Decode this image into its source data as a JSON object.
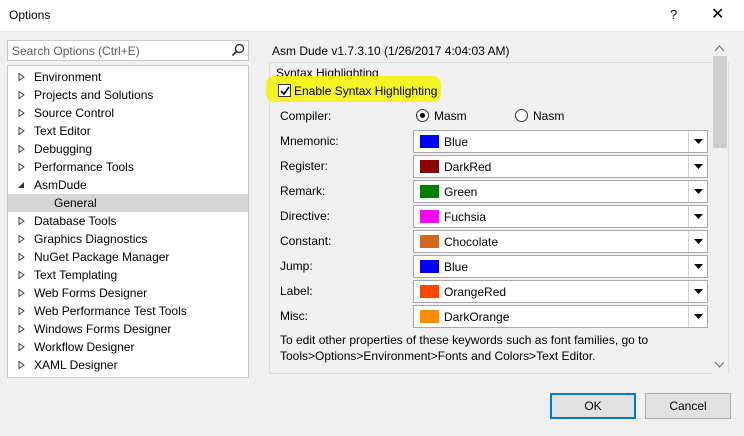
{
  "window": {
    "title": "Options",
    "help_label": "?",
    "close_label": "✕"
  },
  "search": {
    "placeholder": "Search Options (Ctrl+E)"
  },
  "tree": {
    "items": [
      {
        "label": "Environment",
        "expanded": false
      },
      {
        "label": "Projects and Solutions",
        "expanded": false
      },
      {
        "label": "Source Control",
        "expanded": false
      },
      {
        "label": "Text Editor",
        "expanded": false
      },
      {
        "label": "Debugging",
        "expanded": false
      },
      {
        "label": "Performance Tools",
        "expanded": false
      },
      {
        "label": "AsmDude",
        "expanded": true
      },
      {
        "label": "General",
        "child": true,
        "selected": true
      },
      {
        "label": "Database Tools",
        "expanded": false
      },
      {
        "label": "Graphics Diagnostics",
        "expanded": false
      },
      {
        "label": "NuGet Package Manager",
        "expanded": false
      },
      {
        "label": "Text Templating",
        "expanded": false
      },
      {
        "label": "Web Forms Designer",
        "expanded": false
      },
      {
        "label": "Web Performance Test Tools",
        "expanded": false
      },
      {
        "label": "Windows Forms Designer",
        "expanded": false
      },
      {
        "label": "Workflow Designer",
        "expanded": false
      },
      {
        "label": "XAML Designer",
        "expanded": false
      }
    ]
  },
  "panel": {
    "header": "Asm Dude v1.7.3.10 (1/26/2017 4:04:03 AM)",
    "group_label": "Syntax Highlighting",
    "enable_label": "Enable Syntax Highlighting",
    "enable_checked": true,
    "compiler": {
      "label": "Compiler:",
      "options": [
        "Masm",
        "Nasm"
      ],
      "selected": "Masm"
    },
    "colors": [
      {
        "label": "Mnemonic:",
        "value": "Blue",
        "hex": "#0000ff"
      },
      {
        "label": "Register:",
        "value": "DarkRed",
        "hex": "#8b0000"
      },
      {
        "label": "Remark:",
        "value": "Green",
        "hex": "#008000"
      },
      {
        "label": "Directive:",
        "value": "Fuchsia",
        "hex": "#ff00ff"
      },
      {
        "label": "Constant:",
        "value": "Chocolate",
        "hex": "#d2691e"
      },
      {
        "label": "Jump:",
        "value": "Blue",
        "hex": "#0000ff"
      },
      {
        "label": "Label:",
        "value": "OrangeRed",
        "hex": "#ff4500"
      },
      {
        "label": "Misc:",
        "value": "DarkOrange",
        "hex": "#ff8c00"
      }
    ],
    "note_line1": "To edit other properties of these keywords such as font families, go to",
    "note_line2": "Tools>Options>Environment>Fonts and Colors>Text Editor."
  },
  "buttons": {
    "ok": "OK",
    "cancel": "Cancel"
  }
}
